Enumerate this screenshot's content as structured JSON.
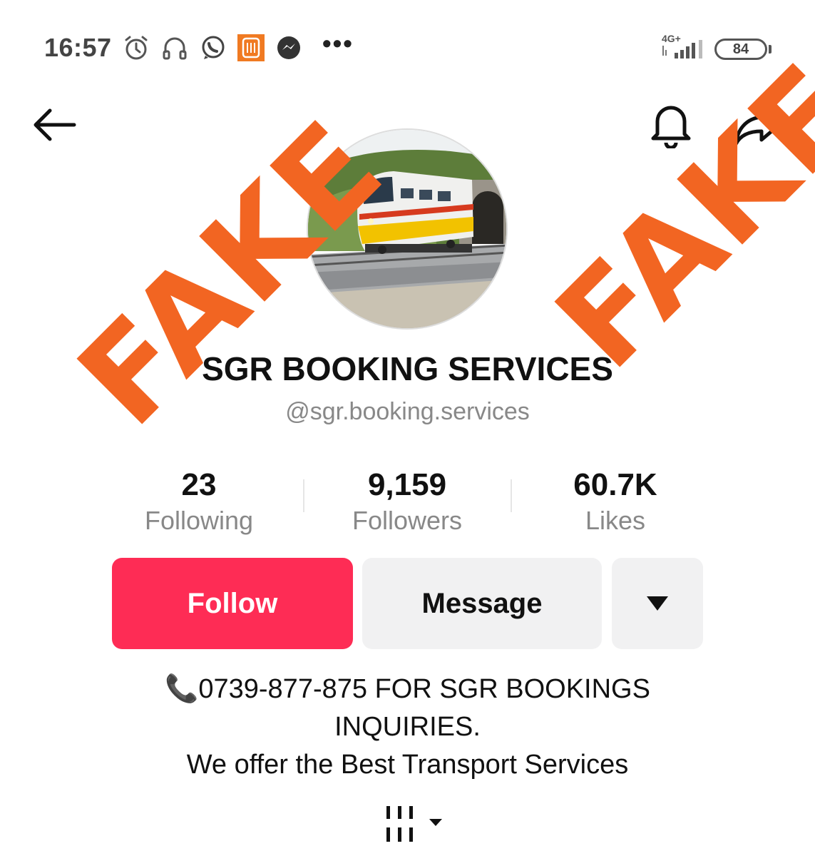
{
  "status_bar": {
    "time": "16:57",
    "icons": [
      "alarm-icon",
      "headset-icon",
      "whatsapp-icon",
      "orange-app-icon",
      "messenger-icon"
    ],
    "more": "•••",
    "network": "4G+",
    "battery": "84"
  },
  "nav": {
    "back_icon": "arrow-left-icon",
    "bell_icon": "bell-icon",
    "share_icon": "share-icon"
  },
  "profile": {
    "name": "SGR BOOKING SERVICES",
    "handle": "@sgr.booking.services"
  },
  "stats": [
    {
      "value": "23",
      "label": "Following"
    },
    {
      "value": "9,159",
      "label": "Followers"
    },
    {
      "value": "60.7K",
      "label": "Likes"
    }
  ],
  "actions": {
    "follow": "Follow",
    "message": "Message"
  },
  "bio": {
    "line1": "📞0739-877-875 FOR SGR BOOKINGS",
    "line2": "INQUIRIES.",
    "line3": "We offer the Best Transport Services"
  },
  "stamp": {
    "left": "FAKE",
    "right": "FAKE"
  },
  "colors": {
    "follow_button": "#fe2c55",
    "stamp": "#f26522",
    "secondary_button": "#f1f1f2"
  }
}
